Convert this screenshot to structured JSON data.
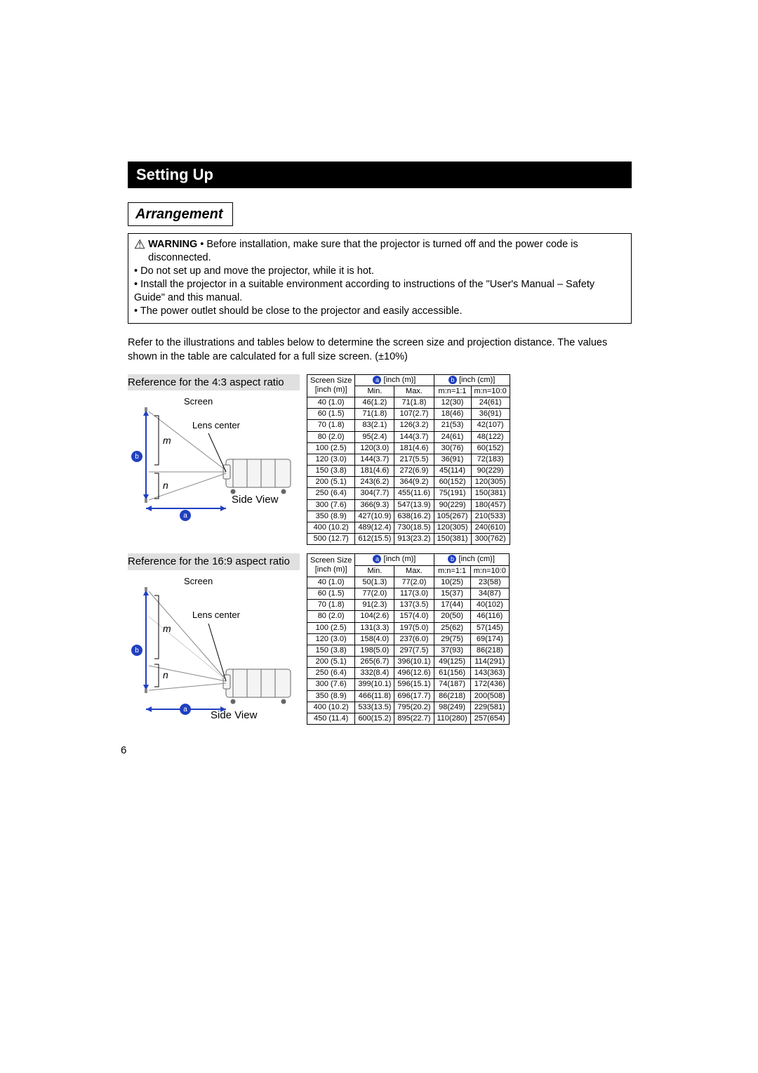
{
  "heading": "Setting Up",
  "subheading": "Arrangement",
  "warning": {
    "label": "WARNING",
    "b1": "• Before installation, make sure that the projector is turned off and the power code is disconnected.",
    "b2": "• Do not set up and move the projector, while it is hot.",
    "b3": "• Install the projector in a suitable environment according to instructions of the \"User's Manual – Safety Guide\" and this manual.",
    "b4": "• The power outlet should be close to the projector and easily accessible."
  },
  "intro": "Refer to the illustrations and tables below to determine the screen size and projection distance. The values shown in the table are calculated for a full size screen. (±10%)",
  "ref43": "Reference for the 4:3 aspect ratio",
  "ref169": "Reference for the 16:9 aspect ratio",
  "diag": {
    "screen": "Screen",
    "lens": "Lens center",
    "side": "Side View",
    "m": "m",
    "n": "n",
    "a": "a",
    "b": "b"
  },
  "tableHead": {
    "ss1": "Screen Size",
    "ss2": "[inch (m)]",
    "a_unit": "[inch (m)]",
    "b_unit": "[inch (cm)]",
    "min": "Min.",
    "max": "Max.",
    "mn11": "m:n=1:1",
    "mn100": "m:n=10:0"
  },
  "chart_data": [
    {
      "type": "table",
      "title": "4:3 aspect ratio",
      "columns": [
        "Screen Size [inch (m)]",
        "a Min. [inch(m)]",
        "a Max. [inch(m)]",
        "b m:n=1:1 [inch(cm)]",
        "b m:n=10:0 [inch(cm)]"
      ],
      "rows": [
        [
          "40 (1.0)",
          "46(1.2)",
          "71(1.8)",
          "12(30)",
          "24(61)"
        ],
        [
          "60 (1.5)",
          "71(1.8)",
          "107(2.7)",
          "18(46)",
          "36(91)"
        ],
        [
          "70 (1.8)",
          "83(2.1)",
          "126(3.2)",
          "21(53)",
          "42(107)"
        ],
        [
          "80 (2.0)",
          "95(2.4)",
          "144(3.7)",
          "24(61)",
          "48(122)"
        ],
        [
          "100 (2.5)",
          "120(3.0)",
          "181(4.6)",
          "30(76)",
          "60(152)"
        ],
        [
          "120 (3.0)",
          "144(3.7)",
          "217(5.5)",
          "36(91)",
          "72(183)"
        ],
        [
          "150 (3.8)",
          "181(4.6)",
          "272(6.9)",
          "45(114)",
          "90(229)"
        ],
        [
          "200 (5.1)",
          "243(6.2)",
          "364(9.2)",
          "60(152)",
          "120(305)"
        ],
        [
          "250 (6.4)",
          "304(7.7)",
          "455(11.6)",
          "75(191)",
          "150(381)"
        ],
        [
          "300 (7.6)",
          "366(9.3)",
          "547(13.9)",
          "90(229)",
          "180(457)"
        ],
        [
          "350 (8.9)",
          "427(10.9)",
          "638(16.2)",
          "105(267)",
          "210(533)"
        ],
        [
          "400 (10.2)",
          "489(12.4)",
          "730(18.5)",
          "120(305)",
          "240(610)"
        ],
        [
          "500 (12.7)",
          "612(15.5)",
          "913(23.2)",
          "150(381)",
          "300(762)"
        ]
      ]
    },
    {
      "type": "table",
      "title": "16:9 aspect ratio",
      "columns": [
        "Screen Size [inch (m)]",
        "a Min. [inch(m)]",
        "a Max. [inch(m)]",
        "b m:n=1:1 [inch(cm)]",
        "b m:n=10:0 [inch(cm)]"
      ],
      "rows": [
        [
          "40 (1.0)",
          "50(1.3)",
          "77(2.0)",
          "10(25)",
          "23(58)"
        ],
        [
          "60 (1.5)",
          "77(2.0)",
          "117(3.0)",
          "15(37)",
          "34(87)"
        ],
        [
          "70 (1.8)",
          "91(2.3)",
          "137(3.5)",
          "17(44)",
          "40(102)"
        ],
        [
          "80 (2.0)",
          "104(2.6)",
          "157(4.0)",
          "20(50)",
          "46(116)"
        ],
        [
          "100 (2.5)",
          "131(3.3)",
          "197(5.0)",
          "25(62)",
          "57(145)"
        ],
        [
          "120 (3.0)",
          "158(4.0)",
          "237(6.0)",
          "29(75)",
          "69(174)"
        ],
        [
          "150 (3.8)",
          "198(5.0)",
          "297(7.5)",
          "37(93)",
          "86(218)"
        ],
        [
          "200 (5.1)",
          "265(6.7)",
          "396(10.1)",
          "49(125)",
          "114(291)"
        ],
        [
          "250 (6.4)",
          "332(8.4)",
          "496(12.6)",
          "61(156)",
          "143(363)"
        ],
        [
          "300 (7.6)",
          "399(10.1)",
          "596(15.1)",
          "74(187)",
          "172(436)"
        ],
        [
          "350 (8.9)",
          "466(11.8)",
          "696(17.7)",
          "86(218)",
          "200(508)"
        ],
        [
          "400 (10.2)",
          "533(13.5)",
          "795(20.2)",
          "98(249)",
          "229(581)"
        ],
        [
          "450 (11.4)",
          "600(15.2)",
          "895(22.7)",
          "110(280)",
          "257(654)"
        ]
      ]
    }
  ],
  "pageNumber": "6"
}
